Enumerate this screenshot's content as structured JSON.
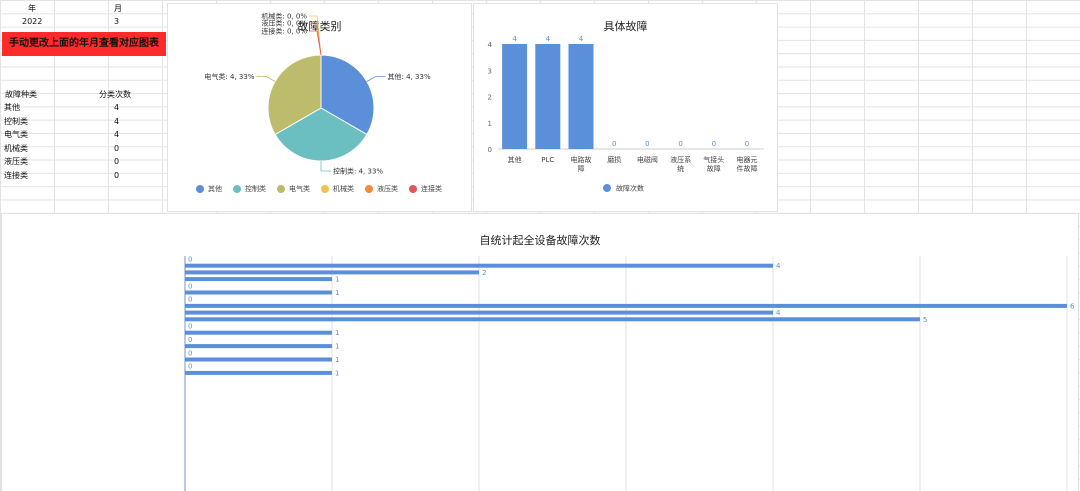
{
  "sheet": {
    "header": {
      "year_label": "年",
      "month_label": "月",
      "year": "2022",
      "month": "3"
    },
    "banner": "手动更改上面的年月查看对应图表",
    "table": {
      "col1": "故障种类",
      "col2": "分类次数",
      "rows": [
        {
          "name": "其他",
          "count": "4"
        },
        {
          "name": "控制类",
          "count": "4"
        },
        {
          "name": "电气类",
          "count": "4"
        },
        {
          "name": "机械类",
          "count": "0"
        },
        {
          "name": "液压类",
          "count": "0"
        },
        {
          "name": "连接类",
          "count": "0"
        }
      ]
    }
  },
  "chart_data": [
    {
      "type": "pie",
      "title": "故障类别",
      "labels": [
        "其他",
        "控制类",
        "电气类",
        "机械类",
        "液压类",
        "连接类"
      ],
      "values": [
        4,
        4,
        4,
        0,
        0,
        0
      ],
      "slice_labels": [
        "其他: 4, 33%",
        "控制类: 4, 33%",
        "电气类: 4, 33%",
        "机械类: 0, 0%",
        "液压类: 0, 0%",
        "连接类: 0, 0%"
      ],
      "colors": [
        "#5b8fd9",
        "#6cbfc1",
        "#bdbb6c",
        "#f2c14e",
        "#f28a3a",
        "#e05a5a"
      ],
      "legend": "bottom"
    },
    {
      "type": "bar",
      "title": "具体故障",
      "categories": [
        "其他",
        "PLC",
        "电路故障",
        "磨损",
        "电磁阀",
        "液压系统",
        "气接头故障",
        "电器元件故障"
      ],
      "category_display": [
        [
          "其他"
        ],
        [
          "PLC"
        ],
        [
          "电路故",
          "障"
        ],
        [
          "磨损"
        ],
        [
          "电磁阀"
        ],
        [
          "液压系",
          "统"
        ],
        [
          "气接头",
          "故障"
        ],
        [
          "电器元",
          "件故障"
        ]
      ],
      "series": [
        {
          "name": "故障次数",
          "values": [
            4,
            4,
            4,
            0,
            0,
            0,
            0,
            0
          ]
        }
      ],
      "ylim": [
        0,
        4
      ],
      "yticks": [
        0,
        1,
        2,
        3,
        4
      ],
      "color": "#5b8fd9",
      "legend": "bottom",
      "grid": false
    },
    {
      "type": "bar",
      "orientation": "horizontal",
      "title": "自统计起全设备故障次数",
      "values": [
        0,
        4,
        2,
        1,
        0,
        1,
        0,
        6,
        4,
        5,
        0,
        1,
        0,
        1,
        0,
        1,
        0,
        1,
        0,
        0,
        0,
        0,
        0,
        0,
        0,
        0,
        0,
        0,
        0,
        0,
        0,
        0,
        0,
        0,
        0
      ],
      "value_labels": [
        "0",
        "4",
        "2",
        "1",
        "0",
        "1",
        "0",
        "6",
        "4",
        "5",
        "0",
        "1",
        "0",
        "1",
        "0",
        "1",
        "0",
        "1",
        "",
        "",
        "",
        "",
        "",
        "",
        "",
        "",
        "",
        "",
        "",
        "",
        "",
        "",
        "",
        "",
        ""
      ],
      "xlim": [
        0,
        6
      ],
      "color": "#5b8fd9",
      "grid": true
    }
  ]
}
